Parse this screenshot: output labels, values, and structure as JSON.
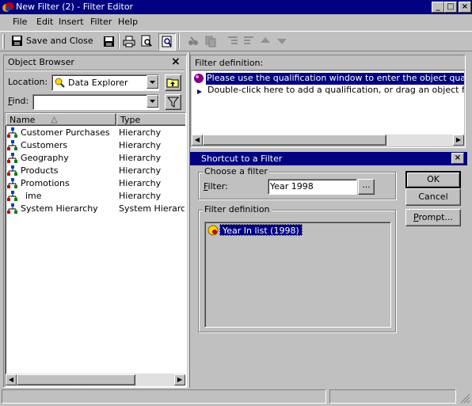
{
  "window": {
    "title": "New Filter (2) - Filter Editor",
    "min": "_",
    "max": "□",
    "close": "×"
  },
  "menu": [
    "File",
    "Edit",
    "Insert",
    "Filter",
    "Help"
  ],
  "toolbar": {
    "save_close_label": "Save and Close"
  },
  "object_browser": {
    "title": "Object Browser",
    "close": "×",
    "location_label": "Location:",
    "location_value": "Data Explorer",
    "find_label": "Find:",
    "find_value": "",
    "columns": {
      "name": "Name",
      "type": "Type"
    },
    "rows": [
      {
        "name": "Customer Purchases",
        "type": "Hierarchy"
      },
      {
        "name": "Customers",
        "type": "Hierarchy"
      },
      {
        "name": "Geography",
        "type": "Hierarchy"
      },
      {
        "name": "Products",
        "type": "Hierarchy"
      },
      {
        "name": "Promotions",
        "type": "Hierarchy"
      },
      {
        "name": "ime",
        "type": "Hierarchy"
      },
      {
        "name": "System Hierarchy",
        "type": "System Hierarc"
      }
    ]
  },
  "filter_definition": {
    "title": "Filter definition:",
    "line1": "Please use the qualification window to enter the object quali",
    "line2": "Double-click here to add a qualification, or drag an object fro"
  },
  "shortcut_dialog": {
    "title": "Shortcut to a Filter",
    "close": "×",
    "choose_group": "Choose a filter",
    "filter_label": "Filter:",
    "filter_value": "Year 1998",
    "browse": "...",
    "definition_group": "Filter definition",
    "definition_item": "Year In list (1998)",
    "ok": "OK",
    "cancel": "Cancel",
    "prompt": "Prompt..."
  },
  "colors": {
    "titlebar": "#000080",
    "face": "#c0c0c0",
    "selection": "#000080"
  }
}
